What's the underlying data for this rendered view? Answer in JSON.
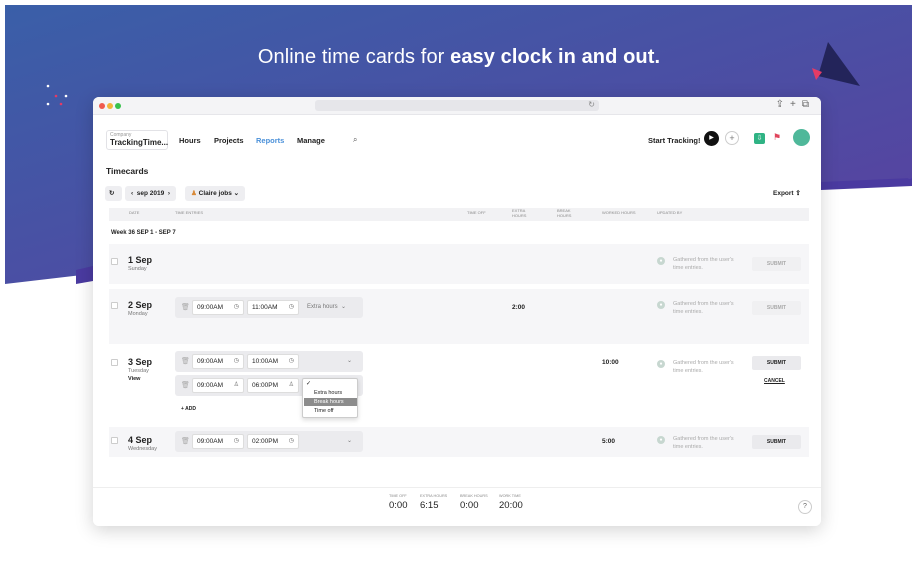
{
  "hero": {
    "headline_prefix": "Online time cards for ",
    "headline_bold": "easy clock in and out."
  },
  "app": {
    "company": {
      "label": "Company",
      "value": "TrackingTime..."
    },
    "nav": {
      "hours": "Hours",
      "projects": "Projects",
      "reports": "Reports",
      "manage": "Manage"
    },
    "start_tracking": "Start Tracking!",
    "page_title": "Timecards",
    "toolbar": {
      "period": "sep 2019",
      "user": "Claire jobs",
      "export": "Export"
    },
    "table_headers": {
      "date": "DATE",
      "time_entries": "TIME ENTRIES",
      "time_off": "TIME OFF",
      "extra_hours": "EXTRA HOURS",
      "break_hours": "BREAK HOURS",
      "worked_hours": "WORKED HOURS",
      "updated_by": "UPDATED BY"
    },
    "week_label": "Week 36  SEP 1 - SEP 7",
    "rows": [
      {
        "day": "1 Sep",
        "weekday": "Sunday",
        "gathered": "Gathered from the user's time entries.",
        "submit": "SUBMIT"
      },
      {
        "day": "2 Sep",
        "weekday": "Monday",
        "start": "09:00AM",
        "end": "11:00AM",
        "type": "Extra hours",
        "extra": "2:00",
        "gathered": "Gathered from the user's time entries.",
        "submit": "SUBMIT"
      },
      {
        "day": "3 Sep",
        "weekday": "Tuesday",
        "view": "View",
        "start": "09:00AM",
        "end": "10:00AM",
        "start2": "09:00AM",
        "end2": "06:00PM",
        "worked": "10:00",
        "gathered": "Gathered from the user's time entries.",
        "submit": "SUBMIT",
        "cancel": "CANCEL",
        "add": "ADD"
      },
      {
        "day": "4 Sep",
        "weekday": "Wednesday",
        "start": "09:00AM",
        "end": "02:00PM",
        "worked": "5:00",
        "gathered": "Gathered from the user's time entries.",
        "submit": "SUBMIT"
      }
    ],
    "dropdown": {
      "options": [
        "Extra hours",
        "Break hours",
        "Time off"
      ],
      "highlighted": "Break hours"
    },
    "footer": {
      "time_off_label": "TIME OFF",
      "time_off": "0:00",
      "extra_label": "EXTRA HOURS",
      "extra": "6:15",
      "break_label": "BREAK HOURS",
      "break": "0:00",
      "work_label": "WORK TIME",
      "work": "20:00"
    }
  },
  "colors": {
    "accent": "#4a90d9",
    "brand_green": "#2fb384",
    "hero_top": "#3f5aa8",
    "hero_bottom": "#5a3f9e"
  }
}
